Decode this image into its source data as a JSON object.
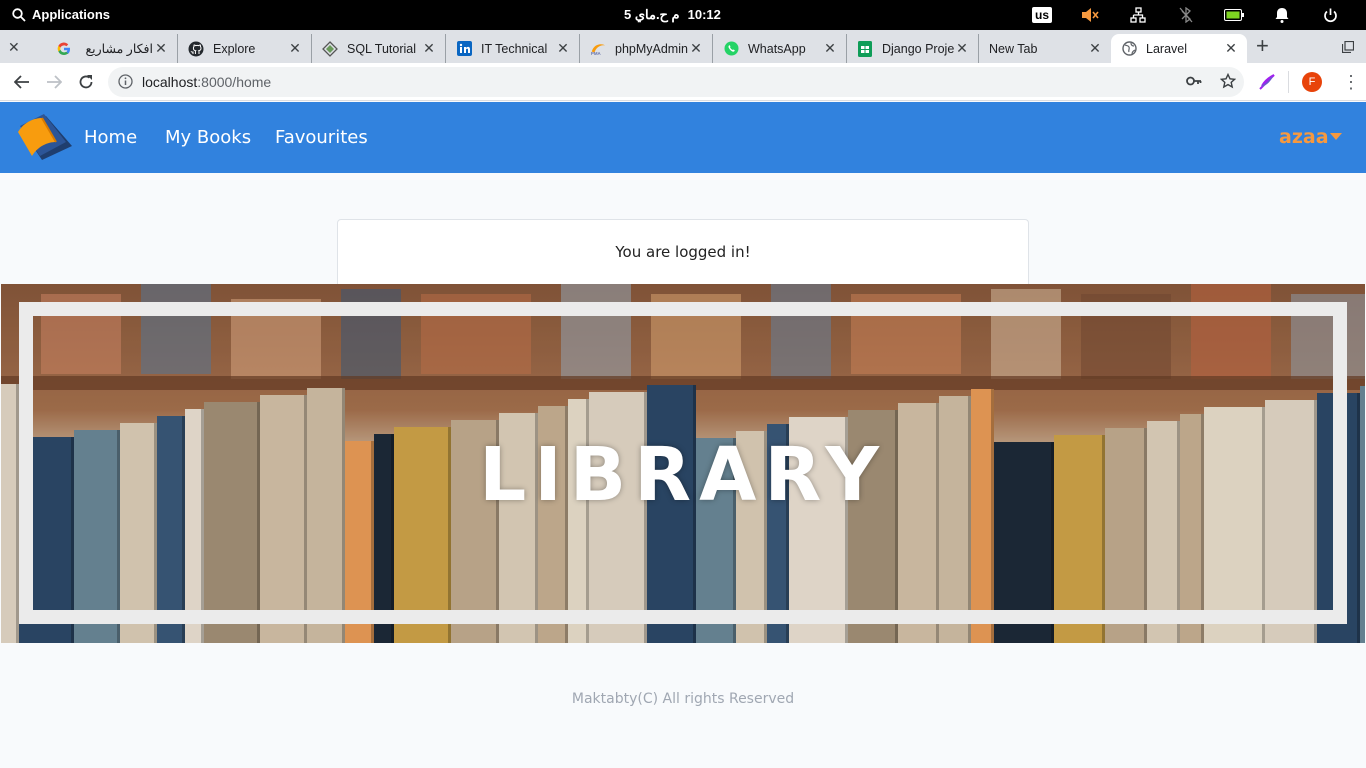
{
  "system": {
    "applications_label": "Applications",
    "clock_time": "10:12",
    "clock_date": "م  ح.ماي 5",
    "keyboard_layout": "us"
  },
  "tabs": [
    {
      "title": "افكار مشاريع",
      "icon": "google-icon"
    },
    {
      "title": "Explore",
      "icon": "github-icon"
    },
    {
      "title": "SQL Tutorial",
      "icon": "sql-icon"
    },
    {
      "title": "IT Technical",
      "icon": "linkedin-icon"
    },
    {
      "title": "phpMyAdmin",
      "icon": "phpmyadmin-icon"
    },
    {
      "title": "WhatsApp",
      "icon": "whatsapp-icon"
    },
    {
      "title": "Django Proje",
      "icon": "sheets-icon"
    },
    {
      "title": "New Tab",
      "icon": ""
    },
    {
      "title": "Laravel",
      "icon": "globe-icon"
    }
  ],
  "address": {
    "host": "localhost",
    "path": ":8000/home"
  },
  "profile_initial": "F",
  "site": {
    "nav": [
      "Home",
      "My Books",
      "Favourites"
    ],
    "user": "azaa",
    "status_message": "You are logged in!",
    "banner_text": "LIBRARY",
    "footer": "Maktabty(C) All rights Reserved"
  },
  "colors": {
    "navbar": "#3182de",
    "accent": "#f6993f",
    "page_bg": "#f8fafc"
  }
}
